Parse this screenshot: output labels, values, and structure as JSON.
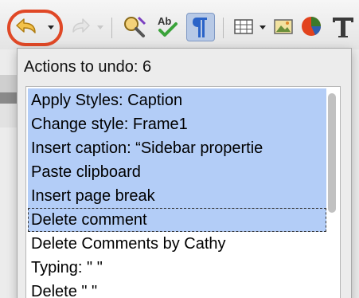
{
  "popup": {
    "title": "Actions to undo: 6"
  },
  "undo_list": {
    "items": [
      {
        "label": "Apply Styles: Caption",
        "selected": true
      },
      {
        "label": "Change style: Frame1",
        "selected": true
      },
      {
        "label": "Insert caption: “Sidebar propertie",
        "selected": true
      },
      {
        "label": "Paste clipboard",
        "selected": true
      },
      {
        "label": "Insert page break",
        "selected": true
      },
      {
        "label": "Delete comment",
        "selected": true,
        "focused": true
      },
      {
        "label": "Delete Comments by Cathy",
        "selected": false
      },
      {
        "label": "Typing: \" \"",
        "selected": false
      },
      {
        "label": "Delete \" \"",
        "selected": false
      }
    ]
  },
  "toolbar": {
    "icons": [
      "undo-icon",
      "redo-icon",
      "find-replace-icon",
      "spelling-icon",
      "formatting-marks-icon",
      "table-icon",
      "image-icon",
      "chart-icon",
      "text-icon"
    ]
  },
  "colors": {
    "highlight_ring": "#e04826",
    "selection": "#b3cdf7"
  }
}
